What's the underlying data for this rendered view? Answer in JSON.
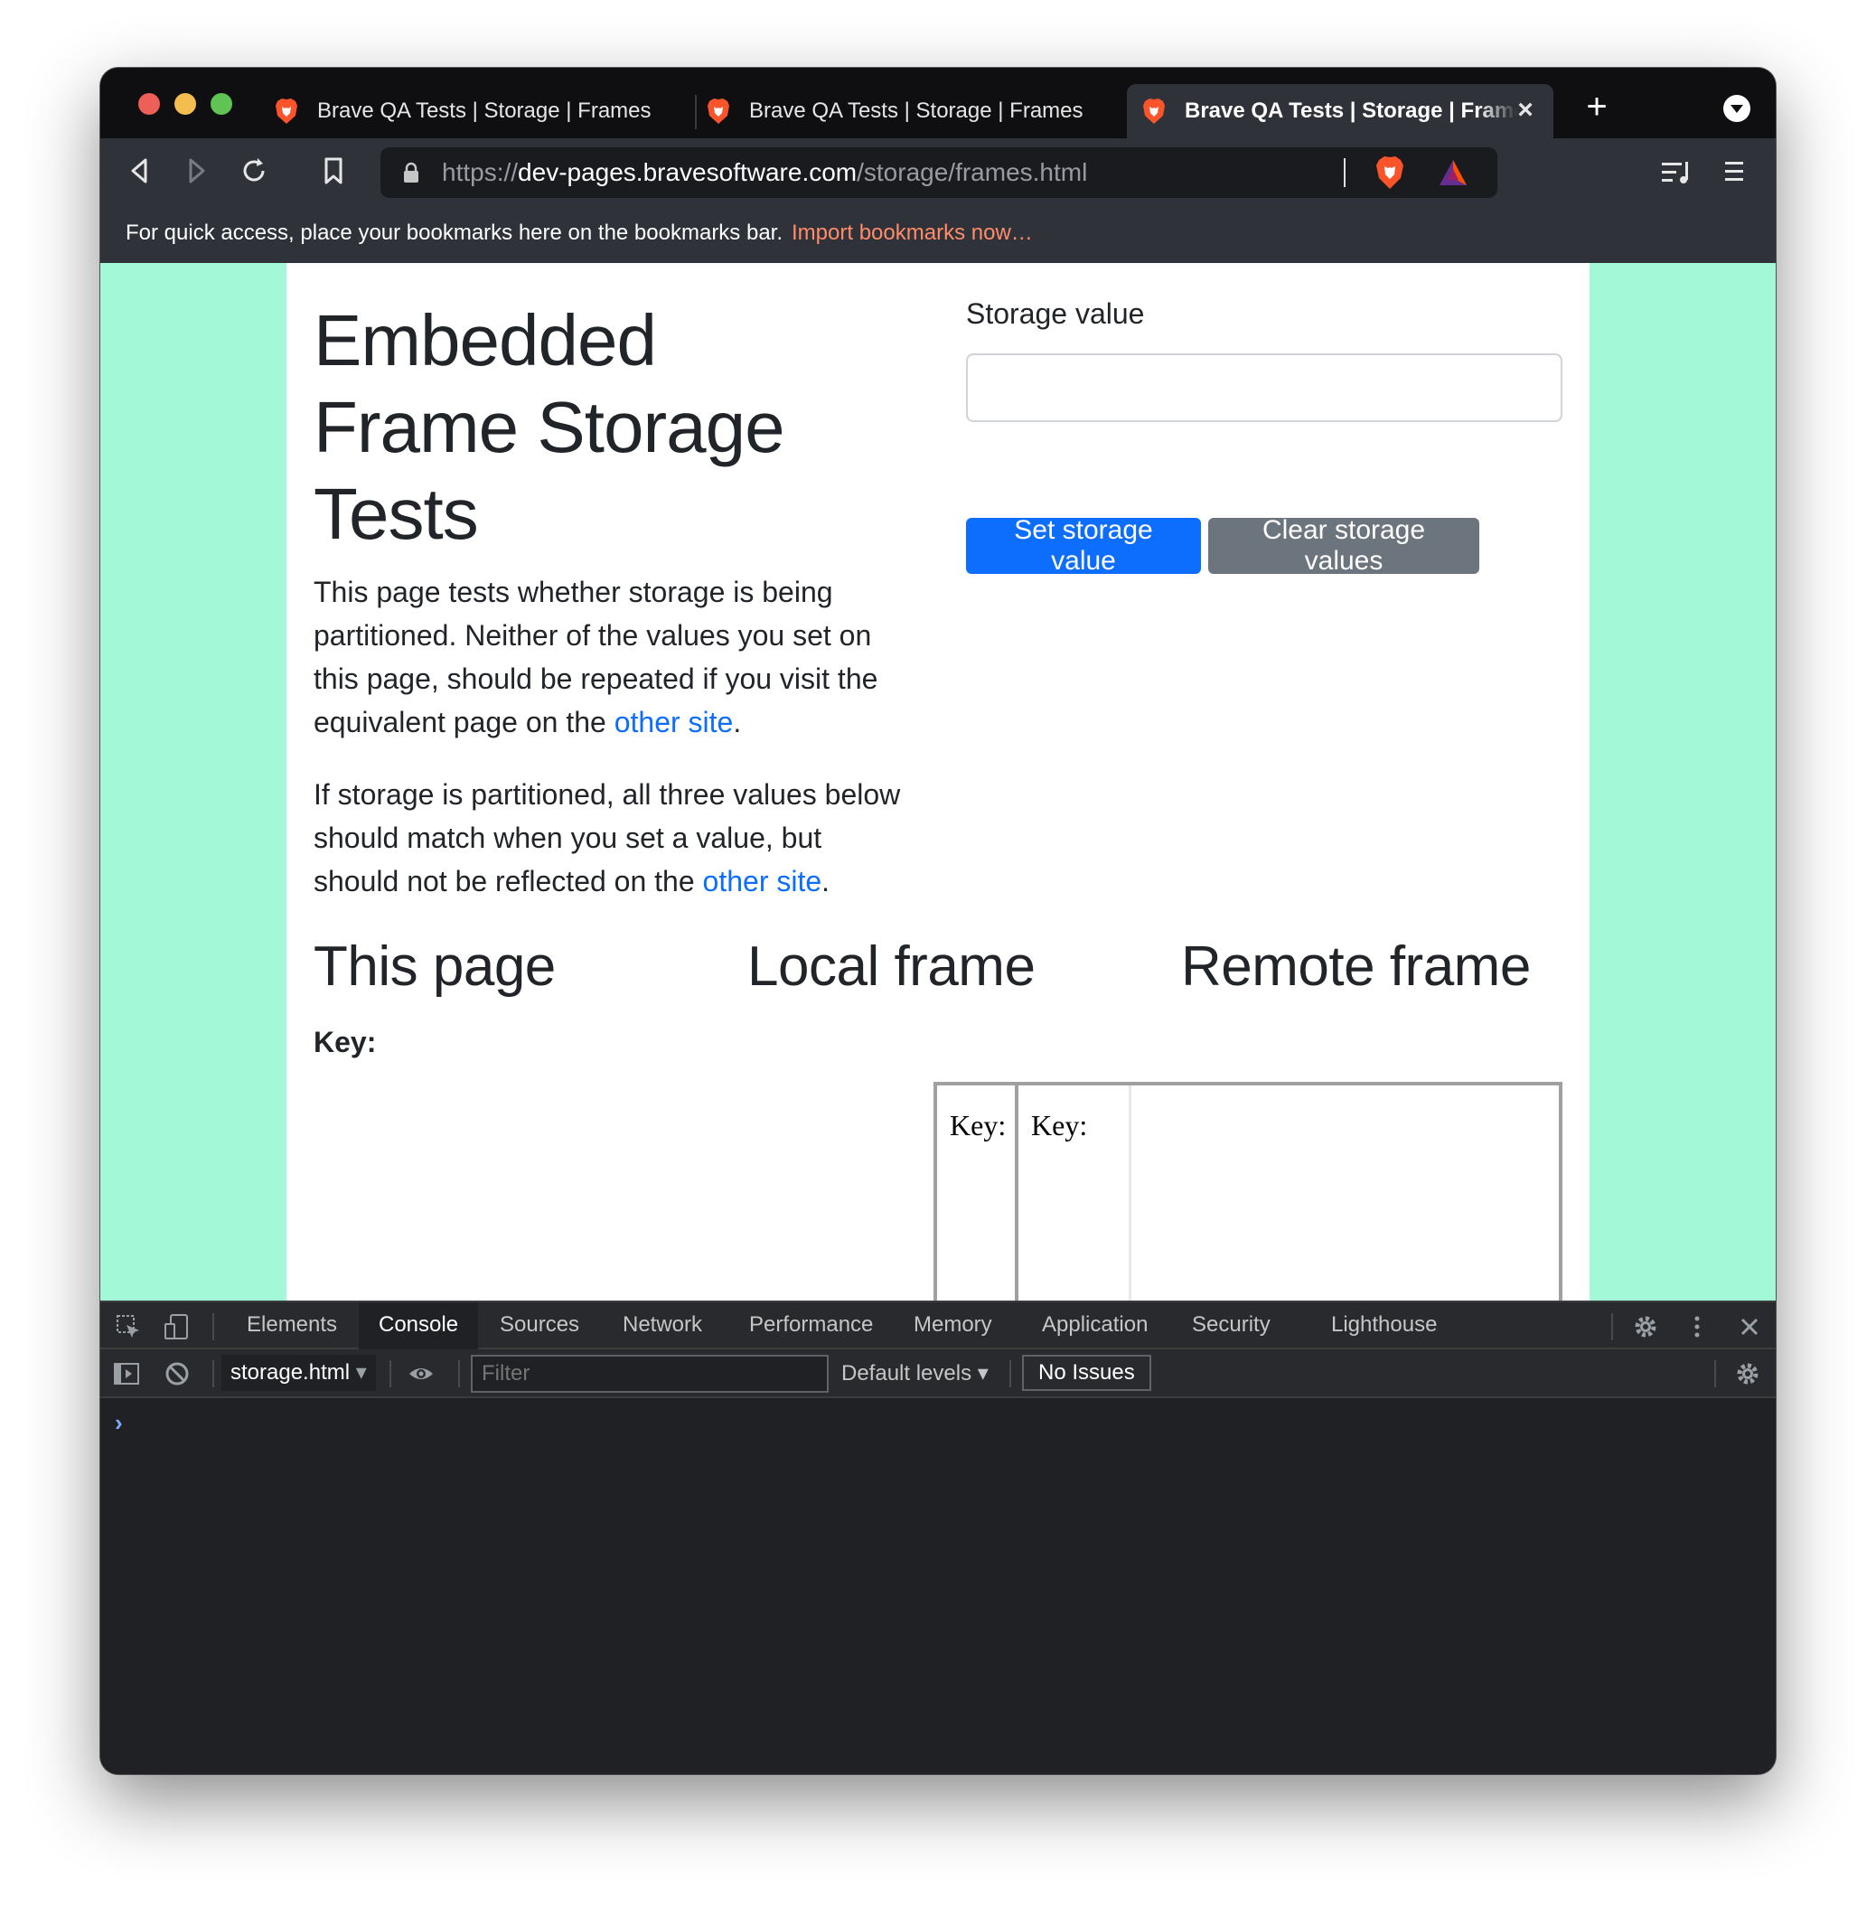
{
  "tabs": [
    {
      "label": "Brave QA Tests | Storage | Frames"
    },
    {
      "label": "Brave QA Tests | Storage | Frames"
    },
    {
      "label": "Brave QA Tests | Storage | Frames",
      "active": true
    }
  ],
  "toolbar": {
    "url_scheme": "https://",
    "url_host": "dev-pages.bravesoftware.com",
    "url_path": "/storage/frames.html"
  },
  "bookmarks_bar": {
    "message": "For quick access, place your bookmarks here on the bookmarks bar.",
    "import_link": "Import bookmarks now…"
  },
  "page": {
    "title": "Embedded Frame Storage Tests",
    "para1_text": "This page tests whether storage is being partitioned. Neither of the values you set on this page, should be repeated if you visit the equivalent page on the ",
    "para1_link": "other site",
    "para1_end": ".",
    "para2_text": "If storage is partitioned, all three values below should match when you set a value, but should not be reflected on the ",
    "para2_link": "other site",
    "para2_end": ".",
    "storage_label": "Storage value",
    "storage_input_value": "",
    "set_button": "Set storage value",
    "clear_button": "Clear storage values",
    "col_this_page": "This page",
    "col_local_frame": "Local frame",
    "col_remote_frame": "Remote frame",
    "this_page_key": "Key:",
    "local_frame_key": "Key:",
    "remote_frame_key": "Key:",
    "background_color": "#a1f9d7"
  },
  "devtools": {
    "tabs": [
      "Elements",
      "Console",
      "Sources",
      "Network",
      "Performance",
      "Memory",
      "Application",
      "Security",
      "Lighthouse"
    ],
    "active_tab": "Console",
    "context": "storage.html",
    "filter_placeholder": "Filter",
    "levels": "Default levels",
    "issues": "No Issues",
    "prompt": "›"
  },
  "colors": {
    "primary_button": "#0d6efd",
    "secondary_button": "#6c757d",
    "link": "#0d6efd",
    "import_link": "#ff8c6a"
  }
}
